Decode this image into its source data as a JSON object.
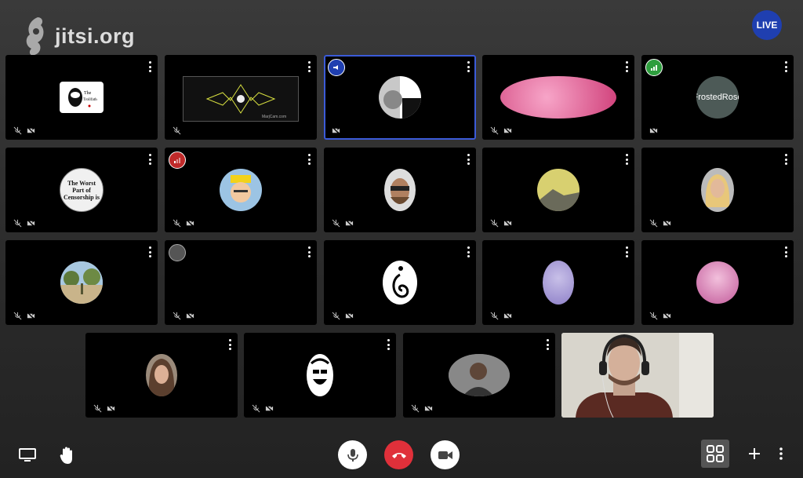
{
  "brand": {
    "logo_text": "jitsi.org"
  },
  "live_badge": "LIVE",
  "participants": [
    {
      "id": "p1",
      "label": ""
    },
    {
      "id": "p2",
      "label": ""
    },
    {
      "id": "p3",
      "label": ""
    },
    {
      "id": "p4",
      "label": ""
    },
    {
      "id": "p5",
      "label": "FrostedRose"
    },
    {
      "id": "p6",
      "label": "The Worst Part of Censorship is"
    },
    {
      "id": "p7",
      "label": ""
    },
    {
      "id": "p8",
      "label": ""
    },
    {
      "id": "p9",
      "label": ""
    },
    {
      "id": "p10",
      "label": ""
    },
    {
      "id": "p11",
      "label": ""
    },
    {
      "id": "p12",
      "label": ""
    },
    {
      "id": "p13",
      "label": ""
    },
    {
      "id": "p14",
      "label": ""
    },
    {
      "id": "p15",
      "label": ""
    },
    {
      "id": "p16",
      "label": ""
    },
    {
      "id": "p17",
      "label": ""
    },
    {
      "id": "p18",
      "label": ""
    },
    {
      "id": "p19",
      "label": ""
    }
  ],
  "colors": {
    "live": "#1f3fb0",
    "hangup": "#e0303a",
    "active_border": "#3b5bd8",
    "good_connection": "#2e9e3e",
    "poor_connection": "#c02a2a"
  },
  "icons": {
    "screen_share": "monitor-icon",
    "raise_hand": "hand-icon",
    "microphone": "microphone-icon",
    "hangup": "phone-hangup-icon",
    "camera": "video-camera-icon",
    "tile_view": "grid-icon",
    "invite": "plus-icon",
    "more": "more-vertical-icon"
  }
}
